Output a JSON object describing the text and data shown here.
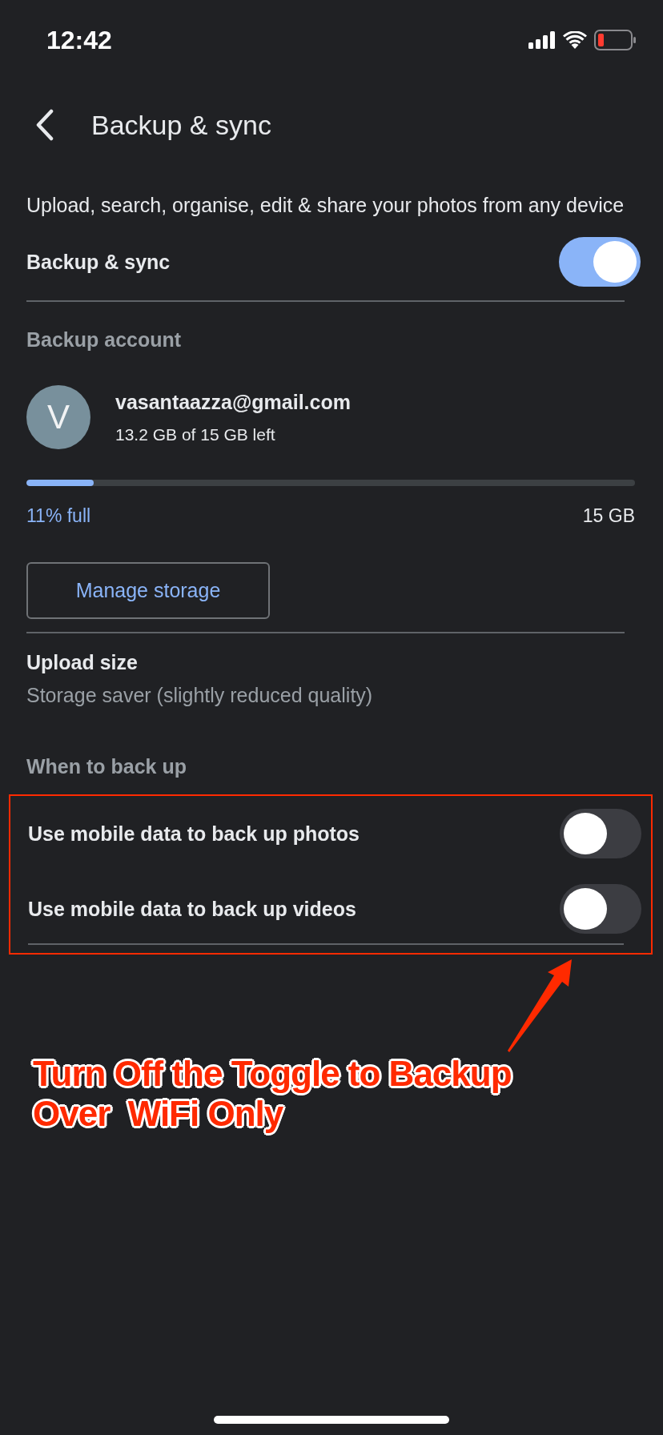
{
  "status_bar": {
    "time": "12:42"
  },
  "header": {
    "title": "Backup & sync"
  },
  "description": "Upload, search, organise, edit & share your photos from any device",
  "backup_sync": {
    "label": "Backup & sync",
    "on": true
  },
  "backup_account": {
    "heading": "Backup account",
    "avatar_letter": "V",
    "email": "vasantaazza@gmail.com",
    "storage_left": "13.2 GB of 15 GB left",
    "usage": {
      "level": 0.11,
      "used_label": "11% full",
      "total_label": "15 GB"
    },
    "manage_button": "Manage storage"
  },
  "upload_size": {
    "title": "Upload size",
    "value": "Storage saver (slightly reduced quality)"
  },
  "when_to_back_up": {
    "heading": "When to back up",
    "options": [
      {
        "label": "Use mobile data to back up photos",
        "on": false
      },
      {
        "label": "Use mobile data to back up videos",
        "on": false
      }
    ]
  },
  "annotation": {
    "lines": [
      "Turn Off the Toggle to Backup",
      "Over  WiFi Only"
    ]
  }
}
